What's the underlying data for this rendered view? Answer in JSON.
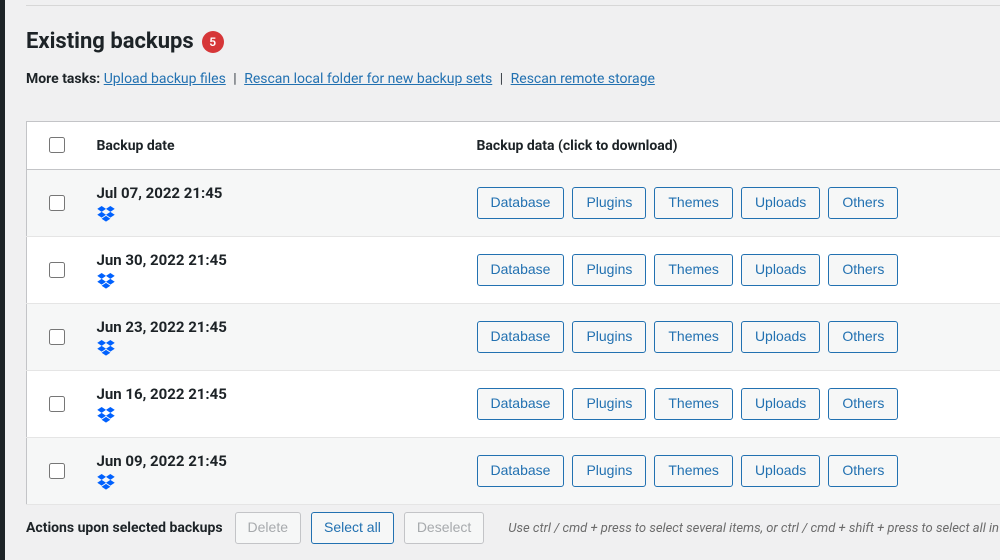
{
  "heading": {
    "title": "Existing backups",
    "count": "5"
  },
  "more_tasks": {
    "label": "More tasks:",
    "upload": "Upload backup files",
    "rescan_local": "Rescan local folder for new backup sets",
    "rescan_remote": "Rescan remote storage"
  },
  "table": {
    "col_date": "Backup date",
    "col_data": "Backup data (click to download)"
  },
  "data_labels": {
    "database": "Database",
    "plugins": "Plugins",
    "themes": "Themes",
    "uploads": "Uploads",
    "others": "Others"
  },
  "backups": [
    {
      "date": "Jul 07, 2022 21:45",
      "storage": "dropbox"
    },
    {
      "date": "Jun 30, 2022 21:45",
      "storage": "dropbox"
    },
    {
      "date": "Jun 23, 2022 21:45",
      "storage": "dropbox"
    },
    {
      "date": "Jun 16, 2022 21:45",
      "storage": "dropbox"
    },
    {
      "date": "Jun 09, 2022 21:45",
      "storage": "dropbox"
    }
  ],
  "actions": {
    "label": "Actions upon selected backups",
    "delete": "Delete",
    "select_all": "Select all",
    "deselect": "Deselect",
    "hint": "Use ctrl / cmd + press to select several items, or ctrl / cmd + shift + press to select all in between"
  }
}
